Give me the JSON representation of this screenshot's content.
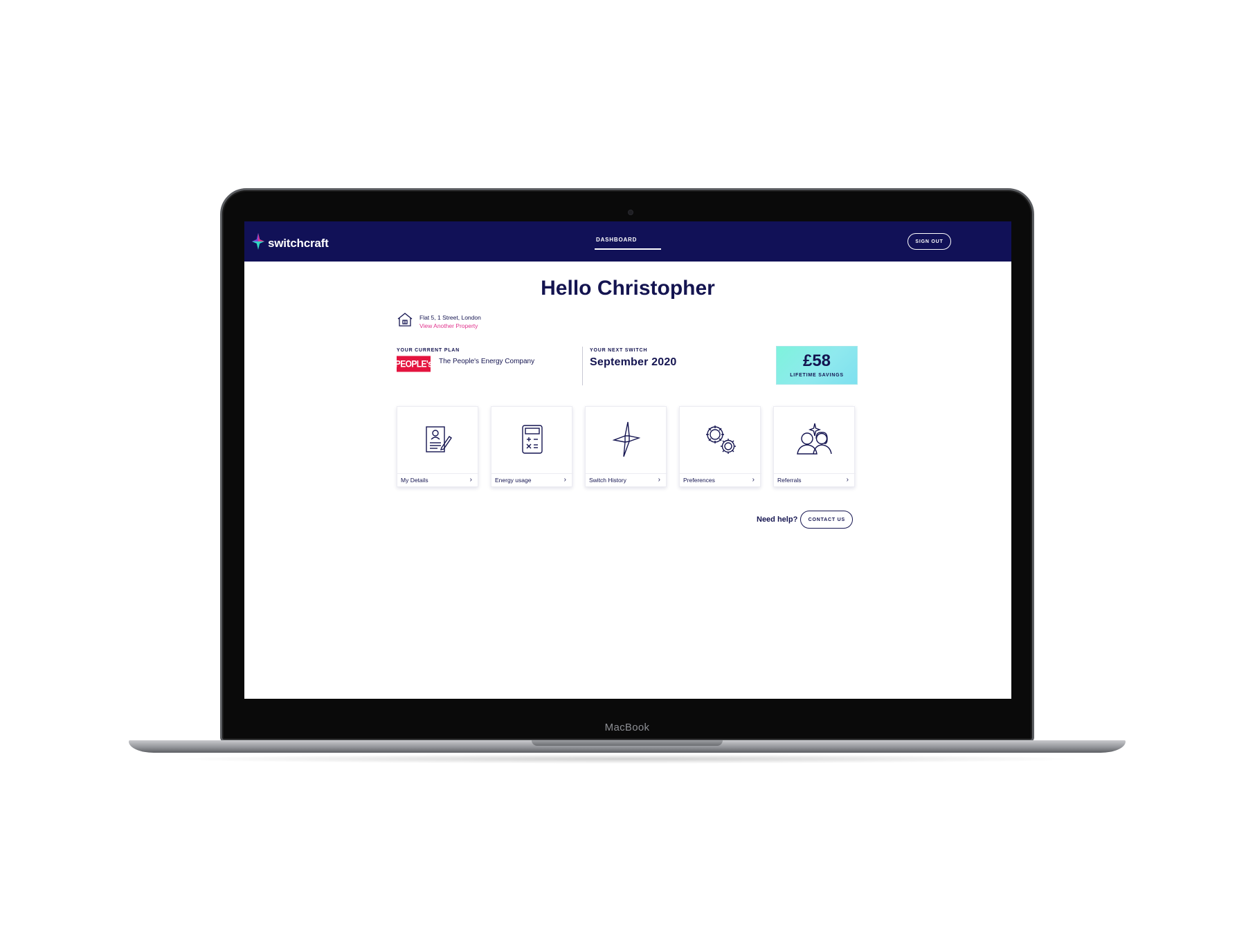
{
  "device": {
    "bezel_label": "MacBook"
  },
  "header": {
    "brand": "switchcraft",
    "nav_tab": "DASHBOARD",
    "signout_label": "SIGN OUT",
    "background_color": "#111157"
  },
  "main": {
    "greeting": "Hello Christopher",
    "property": {
      "address": "Flat 5, 1 Street, London",
      "link": "View Another Property"
    },
    "current_plan": {
      "label": "YOUR CURRENT PLAN",
      "supplier_logo": "PEOPLE's",
      "supplier_name": "The People's Energy Company"
    },
    "next_switch": {
      "label": "YOUR NEXT SWITCH",
      "date": "September 2020"
    },
    "savings": {
      "amount": "£58",
      "label": "LIFETIME SAVINGS"
    },
    "tiles": [
      {
        "label": "My Details",
        "icon": "document-edit-icon"
      },
      {
        "label": "Energy usage",
        "icon": "calculator-icon"
      },
      {
        "label": "Switch History",
        "icon": "switch-spark-icon"
      },
      {
        "label": "Preferences",
        "icon": "gears-icon"
      },
      {
        "label": "Referrals",
        "icon": "people-icon"
      }
    ],
    "help": {
      "text": "Need help?",
      "button": "CONTACT US"
    }
  },
  "colors": {
    "navy": "#141450",
    "accent_pink": "#e0338c",
    "savings_gradient_start": "#7ef3dc",
    "savings_gradient_end": "#7ee0ef",
    "peoples_red": "#e4143f"
  }
}
